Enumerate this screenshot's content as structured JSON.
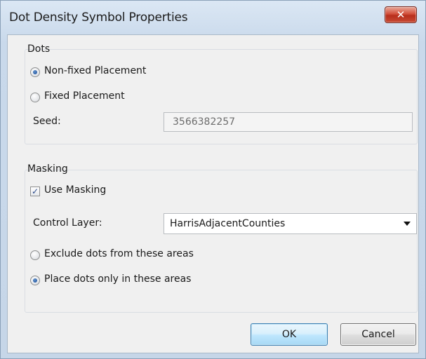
{
  "window": {
    "title": "Dot Density Symbol Properties",
    "close_glyph": "✕"
  },
  "dots_group": {
    "label": "Dots",
    "nonfixed_label": "Non-fixed Placement",
    "nonfixed_selected": true,
    "fixed_label": "Fixed Placement",
    "fixed_selected": false,
    "seed_label": "Seed:",
    "seed_value": "3566382257"
  },
  "masking_group": {
    "label": "Masking",
    "use_masking_label": "Use Masking",
    "use_masking_checked": true,
    "check_glyph": "✓",
    "control_layer_label": "Control Layer:",
    "control_layer_value": "HarrisAdjacentCounties",
    "exclude_label": "Exclude dots from these areas",
    "exclude_selected": false,
    "place_label": "Place dots only in these areas",
    "place_selected": true
  },
  "buttons": {
    "ok_label": "OK",
    "cancel_label": "Cancel"
  },
  "icons": {
    "close": "close-icon",
    "dropdown": "chevron-down-icon",
    "checkmark": "checkmark-icon"
  },
  "colors": {
    "close_button": "#c84a33",
    "default_button_border": "#3c7fb1",
    "radio_dot": "#1c4f9b"
  }
}
